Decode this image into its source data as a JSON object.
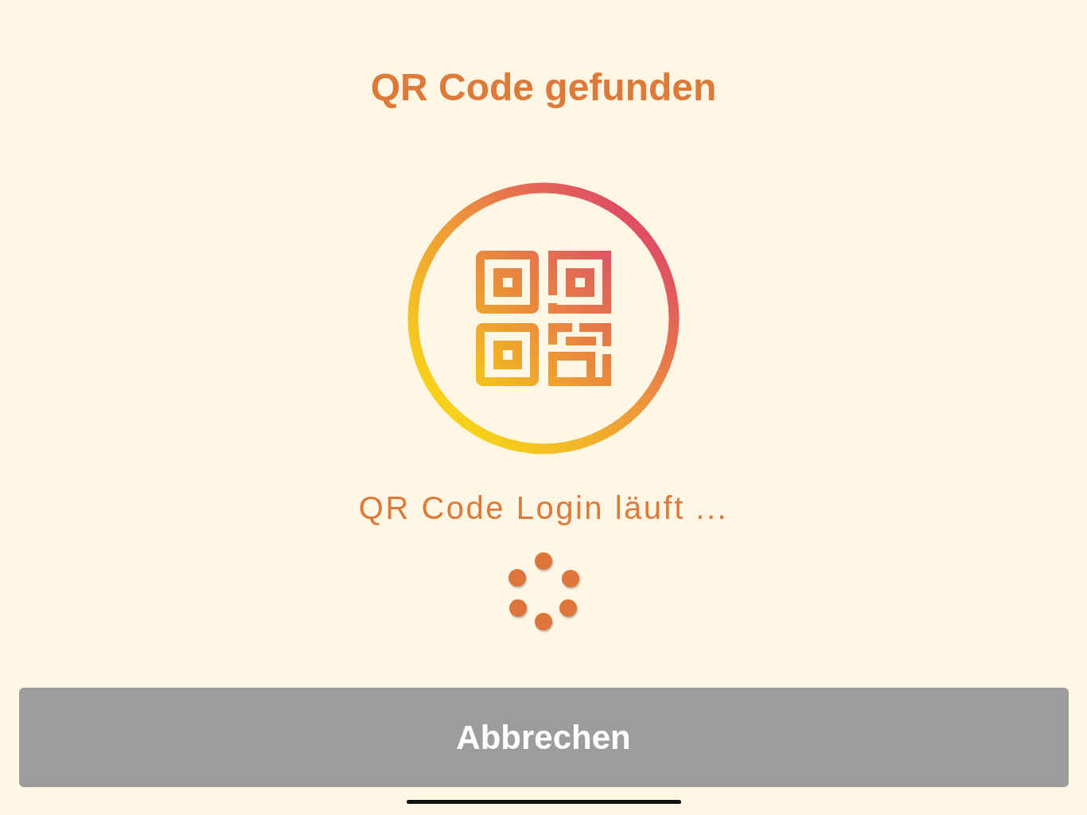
{
  "title": "QR Code gefunden",
  "status": "QR Code Login läuft ...",
  "cancel_button": {
    "label": "Abbrechen"
  }
}
